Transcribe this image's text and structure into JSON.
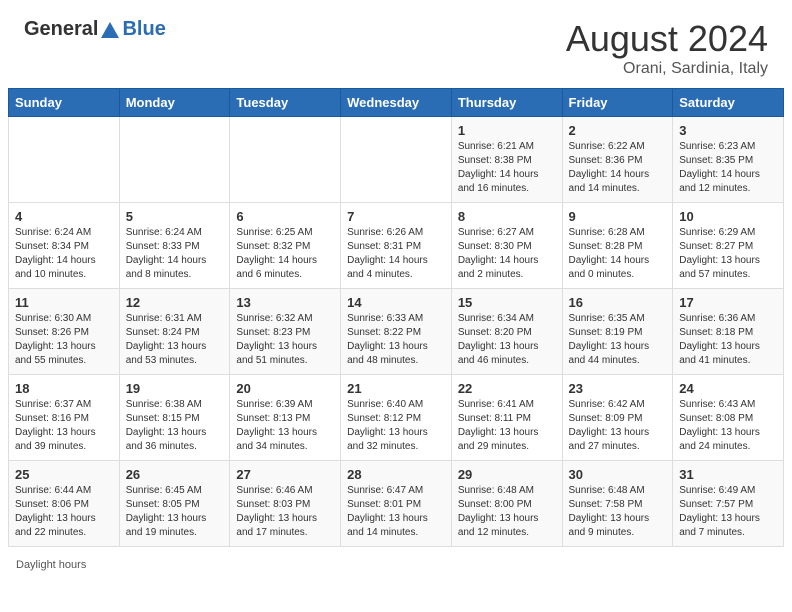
{
  "header": {
    "logo_general": "General",
    "logo_blue": "Blue",
    "month_year": "August 2024",
    "location": "Orani, Sardinia, Italy"
  },
  "calendar": {
    "days_of_week": [
      "Sunday",
      "Monday",
      "Tuesday",
      "Wednesday",
      "Thursday",
      "Friday",
      "Saturday"
    ],
    "weeks": [
      [
        {
          "day": "",
          "info": ""
        },
        {
          "day": "",
          "info": ""
        },
        {
          "day": "",
          "info": ""
        },
        {
          "day": "",
          "info": ""
        },
        {
          "day": "1",
          "info": "Sunrise: 6:21 AM\nSunset: 8:38 PM\nDaylight: 14 hours and 16 minutes."
        },
        {
          "day": "2",
          "info": "Sunrise: 6:22 AM\nSunset: 8:36 PM\nDaylight: 14 hours and 14 minutes."
        },
        {
          "day": "3",
          "info": "Sunrise: 6:23 AM\nSunset: 8:35 PM\nDaylight: 14 hours and 12 minutes."
        }
      ],
      [
        {
          "day": "4",
          "info": "Sunrise: 6:24 AM\nSunset: 8:34 PM\nDaylight: 14 hours and 10 minutes."
        },
        {
          "day": "5",
          "info": "Sunrise: 6:24 AM\nSunset: 8:33 PM\nDaylight: 14 hours and 8 minutes."
        },
        {
          "day": "6",
          "info": "Sunrise: 6:25 AM\nSunset: 8:32 PM\nDaylight: 14 hours and 6 minutes."
        },
        {
          "day": "7",
          "info": "Sunrise: 6:26 AM\nSunset: 8:31 PM\nDaylight: 14 hours and 4 minutes."
        },
        {
          "day": "8",
          "info": "Sunrise: 6:27 AM\nSunset: 8:30 PM\nDaylight: 14 hours and 2 minutes."
        },
        {
          "day": "9",
          "info": "Sunrise: 6:28 AM\nSunset: 8:28 PM\nDaylight: 14 hours and 0 minutes."
        },
        {
          "day": "10",
          "info": "Sunrise: 6:29 AM\nSunset: 8:27 PM\nDaylight: 13 hours and 57 minutes."
        }
      ],
      [
        {
          "day": "11",
          "info": "Sunrise: 6:30 AM\nSunset: 8:26 PM\nDaylight: 13 hours and 55 minutes."
        },
        {
          "day": "12",
          "info": "Sunrise: 6:31 AM\nSunset: 8:24 PM\nDaylight: 13 hours and 53 minutes."
        },
        {
          "day": "13",
          "info": "Sunrise: 6:32 AM\nSunset: 8:23 PM\nDaylight: 13 hours and 51 minutes."
        },
        {
          "day": "14",
          "info": "Sunrise: 6:33 AM\nSunset: 8:22 PM\nDaylight: 13 hours and 48 minutes."
        },
        {
          "day": "15",
          "info": "Sunrise: 6:34 AM\nSunset: 8:20 PM\nDaylight: 13 hours and 46 minutes."
        },
        {
          "day": "16",
          "info": "Sunrise: 6:35 AM\nSunset: 8:19 PM\nDaylight: 13 hours and 44 minutes."
        },
        {
          "day": "17",
          "info": "Sunrise: 6:36 AM\nSunset: 8:18 PM\nDaylight: 13 hours and 41 minutes."
        }
      ],
      [
        {
          "day": "18",
          "info": "Sunrise: 6:37 AM\nSunset: 8:16 PM\nDaylight: 13 hours and 39 minutes."
        },
        {
          "day": "19",
          "info": "Sunrise: 6:38 AM\nSunset: 8:15 PM\nDaylight: 13 hours and 36 minutes."
        },
        {
          "day": "20",
          "info": "Sunrise: 6:39 AM\nSunset: 8:13 PM\nDaylight: 13 hours and 34 minutes."
        },
        {
          "day": "21",
          "info": "Sunrise: 6:40 AM\nSunset: 8:12 PM\nDaylight: 13 hours and 32 minutes."
        },
        {
          "day": "22",
          "info": "Sunrise: 6:41 AM\nSunset: 8:11 PM\nDaylight: 13 hours and 29 minutes."
        },
        {
          "day": "23",
          "info": "Sunrise: 6:42 AM\nSunset: 8:09 PM\nDaylight: 13 hours and 27 minutes."
        },
        {
          "day": "24",
          "info": "Sunrise: 6:43 AM\nSunset: 8:08 PM\nDaylight: 13 hours and 24 minutes."
        }
      ],
      [
        {
          "day": "25",
          "info": "Sunrise: 6:44 AM\nSunset: 8:06 PM\nDaylight: 13 hours and 22 minutes."
        },
        {
          "day": "26",
          "info": "Sunrise: 6:45 AM\nSunset: 8:05 PM\nDaylight: 13 hours and 19 minutes."
        },
        {
          "day": "27",
          "info": "Sunrise: 6:46 AM\nSunset: 8:03 PM\nDaylight: 13 hours and 17 minutes."
        },
        {
          "day": "28",
          "info": "Sunrise: 6:47 AM\nSunset: 8:01 PM\nDaylight: 13 hours and 14 minutes."
        },
        {
          "day": "29",
          "info": "Sunrise: 6:48 AM\nSunset: 8:00 PM\nDaylight: 13 hours and 12 minutes."
        },
        {
          "day": "30",
          "info": "Sunrise: 6:48 AM\nSunset: 7:58 PM\nDaylight: 13 hours and 9 minutes."
        },
        {
          "day": "31",
          "info": "Sunrise: 6:49 AM\nSunset: 7:57 PM\nDaylight: 13 hours and 7 minutes."
        }
      ]
    ]
  },
  "footer": {
    "daylight_label": "Daylight hours"
  }
}
